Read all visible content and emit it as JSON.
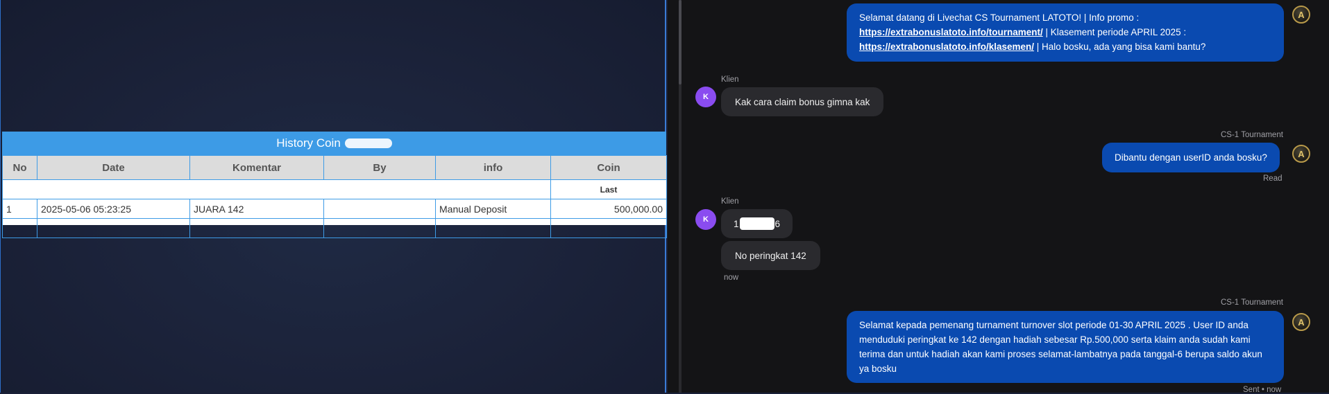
{
  "history": {
    "title": "History Coin",
    "columns": [
      "No",
      "Date",
      "Komentar",
      "By",
      "info",
      "Coin"
    ],
    "last_label": "Last",
    "rows": [
      {
        "no": "1",
        "date": "2025-05-06 05:23:25",
        "komentar": "JUARA 142",
        "by": "",
        "info": "Manual Deposit",
        "coin": "500,000.00"
      }
    ]
  },
  "chat": {
    "msg1": {
      "part1": "Selamat datang di Livechat CS Tournament LATOTO! | Info promo :",
      "link1": "https://extrabonuslatoto.info/tournament/",
      "part2": " | Klasement periode APRIL 2025 :",
      "link2": "https://extrabonuslatoto.info/klasemen/",
      "part3": " | Halo bosku, ada yang bisa kami bantu?"
    },
    "client_label_1": "Klien",
    "client_initial": "K",
    "msg2": "Kak cara claim bonus gimna kak",
    "agent_name_1": "CS-1 Tournament",
    "msg3": "Dibantu dengan userID anda bosku?",
    "read_status": "Read",
    "client_label_2": "Klien",
    "msg4_prefix": "1",
    "msg4_suffix": "6",
    "msg5": "No peringkat 142",
    "time_now": "now",
    "agent_name_2": "CS-1 Tournament",
    "msg6": "Selamat kepada pemenang turnament turnover slot periode 01-30 APRIL 2025 . User ID anda menduduki peringkat ke 142 dengan hadiah sebesar Rp.500,000 serta klaim anda sudah kami terima dan untuk hadiah akan kami proses selamat-lambatnya pada tanggal-6 berupa saldo akun ya bosku",
    "sent_status": "Sent • now",
    "agent_avatar_letter": "A"
  },
  "colors": {
    "agent_bubble": "#0a4ab0",
    "client_bubble": "#2a2a2e",
    "client_avatar": "#8a4cf0",
    "table_header": "#3d9be6",
    "coin_green": "#1f8a1f"
  }
}
